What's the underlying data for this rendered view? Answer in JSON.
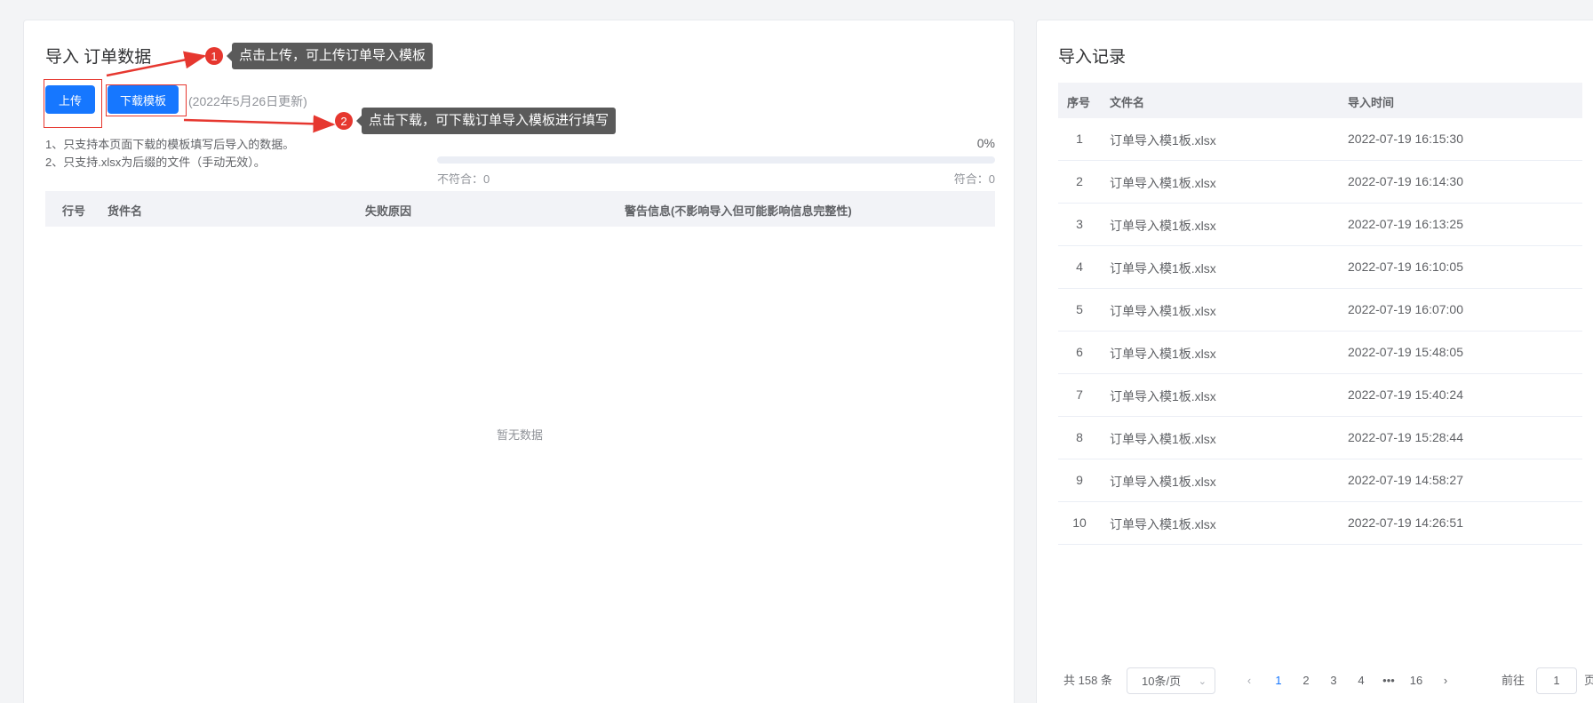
{
  "import_panel": {
    "title": "导入 订单数据",
    "upload_label": "上传",
    "download_label": "下载模板",
    "update_note": "(2022年5月26日更新)",
    "tips": [
      "1、只支持本页面下载的模板填写后导入的数据。",
      "2、只支持.xlsx为后缀的文件（手动无效）。"
    ],
    "progress": {
      "percent_label": "0%",
      "fraction": 0,
      "bad_label": "不符合：0",
      "good_label": "符合：0"
    },
    "columns": [
      "行号",
      "货件名",
      "失败原因",
      "警告信息(不影响导入但可能影响信息完整性)"
    ],
    "empty_text": "暂无数据"
  },
  "annotations": [
    {
      "num": "1",
      "text": "点击上传，可上传订单导入模板"
    },
    {
      "num": "2",
      "text": "点击下载，可下载订单导入模板进行填写"
    }
  ],
  "history_panel": {
    "title": "导入记录",
    "columns": [
      "序号",
      "文件名",
      "导入时间"
    ],
    "rows": [
      {
        "idx": "1",
        "name": "订单导入模1板.xlsx",
        "time": "2022-07-19 16:15:30"
      },
      {
        "idx": "2",
        "name": "订单导入模1板.xlsx",
        "time": "2022-07-19 16:14:30"
      },
      {
        "idx": "3",
        "name": "订单导入模1板.xlsx",
        "time": "2022-07-19 16:13:25"
      },
      {
        "idx": "4",
        "name": "订单导入模1板.xlsx",
        "time": "2022-07-19 16:10:05"
      },
      {
        "idx": "5",
        "name": "订单导入模1板.xlsx",
        "time": "2022-07-19 16:07:00"
      },
      {
        "idx": "6",
        "name": "订单导入模1板.xlsx",
        "time": "2022-07-19 15:48:05"
      },
      {
        "idx": "7",
        "name": "订单导入模1板.xlsx",
        "time": "2022-07-19 15:40:24"
      },
      {
        "idx": "8",
        "name": "订单导入模1板.xlsx",
        "time": "2022-07-19 15:28:44"
      },
      {
        "idx": "9",
        "name": "订单导入模1板.xlsx",
        "time": "2022-07-19 14:58:27"
      },
      {
        "idx": "10",
        "name": "订单导入模1板.xlsx",
        "time": "2022-07-19 14:26:51"
      }
    ],
    "pagination": {
      "total": "共 158 条",
      "page_size": "10条/页",
      "pages": [
        "1",
        "2",
        "3",
        "4",
        "•••",
        "16"
      ],
      "current": "1",
      "goto_label": "前往",
      "goto_value": "1",
      "page_suffix": "页"
    }
  },
  "colors": {
    "primary": "#1677ff",
    "annotation": "#e6372f",
    "tooltip": "#5a5a5a"
  }
}
